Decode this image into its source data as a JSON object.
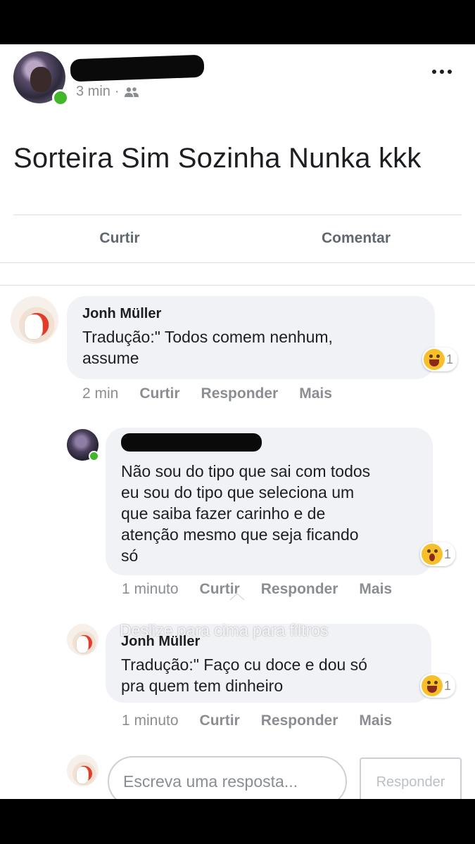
{
  "post": {
    "time": "3 min",
    "separator": "·",
    "audience_icon": "friends-icon",
    "text": "Sorteira Sim Sozinha Nunka kkk",
    "actions": {
      "like": "Curtir",
      "comment": "Comentar"
    }
  },
  "comments": [
    {
      "name": "Jonh Müller",
      "text_line1": "Tradução:\" Todos comem nenhum,",
      "text_line2": "assume",
      "reaction_icon": "laughing-emoji-icon",
      "reaction_count": "1",
      "time": "2 min",
      "like": "Curtir",
      "reply": "Responder",
      "more": "Mais"
    },
    {
      "text_line1": "Não sou do tipo que sai com todos",
      "text_line2": "eu sou do tipo que seleciona um",
      "text_line3": "que saiba fazer carinho e de",
      "text_line4": "atenção mesmo que seja ficando",
      "text_line5": "só",
      "reaction_icon": "wow-emoji-icon",
      "reaction_count": "1",
      "time": "1 minuto",
      "like": "Curtir",
      "reply": "Responder",
      "more": "Mais"
    },
    {
      "name": "Jonh Müller",
      "text_line1": "Tradução:\" Faço cu doce e dou só",
      "text_line2": "pra quem tem dinheiro",
      "reaction_icon": "laughing-emoji-icon",
      "reaction_count": "1",
      "time": "1 minuto",
      "like": "Curtir",
      "reply": "Responder",
      "more": "Mais"
    }
  ],
  "overlay_hint": "Deslize para cima para filtros",
  "reply_bar": {
    "placeholder": "Escreva uma resposta...",
    "send": "Responder"
  },
  "colors": {
    "online": "#42b72a",
    "bubble": "#f0f2f5",
    "text": "#1c1e21",
    "meta": "#8a8d91"
  }
}
